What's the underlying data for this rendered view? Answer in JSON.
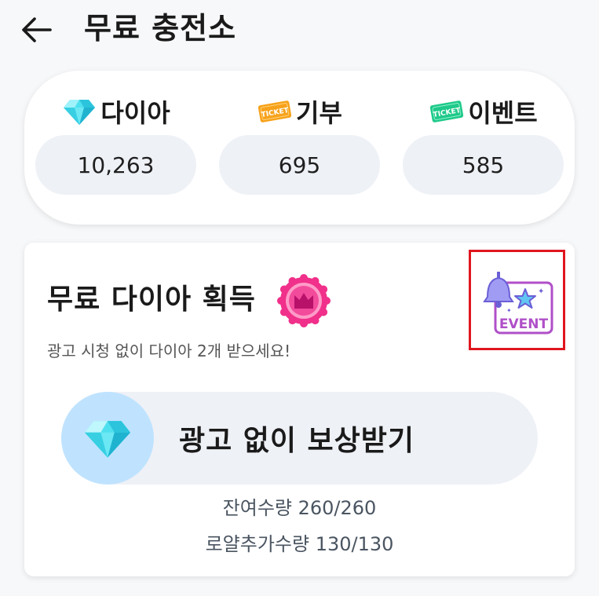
{
  "header": {
    "title": "무료 충전소",
    "back_icon": "arrow-left-icon"
  },
  "currencies": [
    {
      "label": "다이아",
      "value": "10,263",
      "icon": "diamond-icon"
    },
    {
      "label": "기부",
      "value": "695",
      "icon": "ticket-orange-icon",
      "icon_text": "TICKET"
    },
    {
      "label": "이벤트",
      "value": "585",
      "icon": "ticket-green-icon",
      "icon_text": "TICKET"
    }
  ],
  "free_diamond": {
    "title": "무료 다이아 획득",
    "badge_icon": "crown-badge-icon",
    "subtitle": "광고 시청 없이 다이아 2개 받으세요!",
    "event_icon": "event-bell-icon",
    "event_text": "EVENT",
    "reward_button_label": "광고 없이 보상받기",
    "remaining": "잔여수량 260/260",
    "royal_extra": "로얄추가수량 130/130"
  },
  "colors": {
    "accent_pink": "#f0308a",
    "diamond_cyan": "#3fd6e8",
    "ticket_orange": "#f7a21b",
    "ticket_green": "#1ec98a",
    "event_purple": "#a24fc4",
    "highlight_red": "#e0161f"
  }
}
